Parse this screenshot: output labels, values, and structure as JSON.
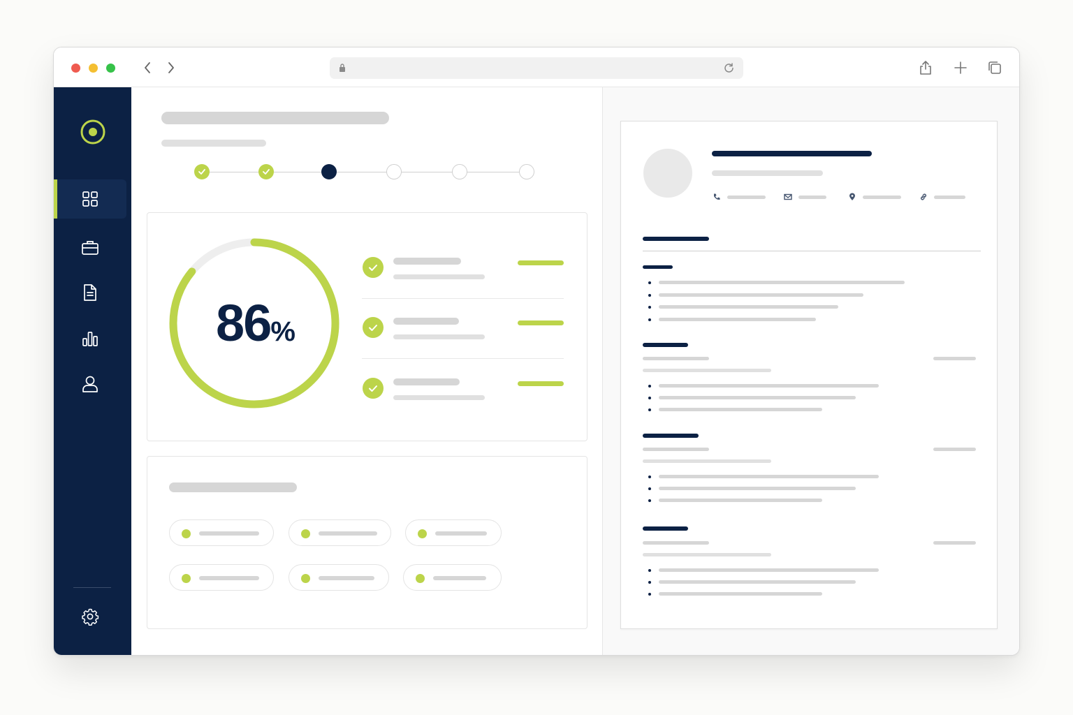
{
  "score": {
    "value": "86",
    "unit": "%",
    "progress": 0.86
  },
  "stepper": {
    "steps": [
      "done",
      "done",
      "current",
      "todo",
      "todo",
      "todo"
    ]
  },
  "icons": {
    "browser": [
      "chevron-left-icon",
      "chevron-right-icon",
      "lock-icon",
      "reload-icon",
      "share-icon",
      "plus-icon",
      "tabs-icon"
    ],
    "sidebar": [
      "logo-icon",
      "dashboard-icon",
      "briefcase-icon",
      "document-icon",
      "bar-chart-icon",
      "user-icon",
      "gear-icon"
    ],
    "contact": [
      "phone-icon",
      "mail-icon",
      "location-icon",
      "link-icon"
    ]
  },
  "colors": {
    "navy": "#0c2144",
    "accent": "#bcd44a",
    "skeleton": "#d6d6d6"
  },
  "checklist": {
    "items": [
      "complete",
      "complete",
      "complete"
    ]
  },
  "chips": {
    "count": 6
  },
  "resume": {
    "sections": 4
  }
}
